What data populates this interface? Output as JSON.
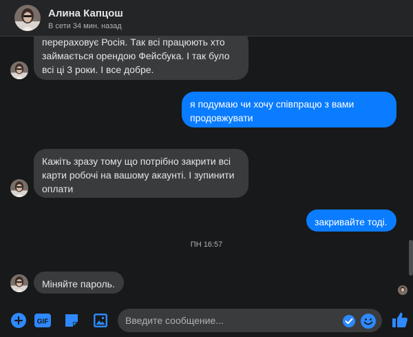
{
  "header": {
    "name": "Алина Капцош",
    "status": "В сети 34 мин. назад"
  },
  "messages": [
    {
      "direction": "in",
      "text": "перераховує Росія. Так всі працюють хто\nзаймається орендою Фейсбука. І так було\nвсі ці 3 роки. І все добре."
    },
    {
      "direction": "out",
      "text": "я подумаю чи хочу співпрацю з вами\nпродовжувати"
    },
    {
      "direction": "in",
      "text": "Кажіть зразу тому що потрібно закрити всі\nкарти робочі на вашому акаунті. І зупинити\nоплати"
    },
    {
      "direction": "out",
      "text": "закривайте тоді."
    },
    {
      "direction": "in",
      "text": "Міняйте пароль."
    }
  ],
  "timestamp": "ПН 16:57",
  "composer": {
    "placeholder": "Введите сообщение...",
    "gif_label": "GIF"
  },
  "icons": [
    "plus-circle-icon",
    "gif-icon",
    "sticker-icon",
    "image-icon",
    "send-check-icon",
    "emoji-icon",
    "like-icon"
  ],
  "colors": {
    "background": "#18191a",
    "incoming_bubble": "#3a3b3c",
    "outgoing_bubble": "#0a7cff",
    "accent": "#2e89ff"
  }
}
